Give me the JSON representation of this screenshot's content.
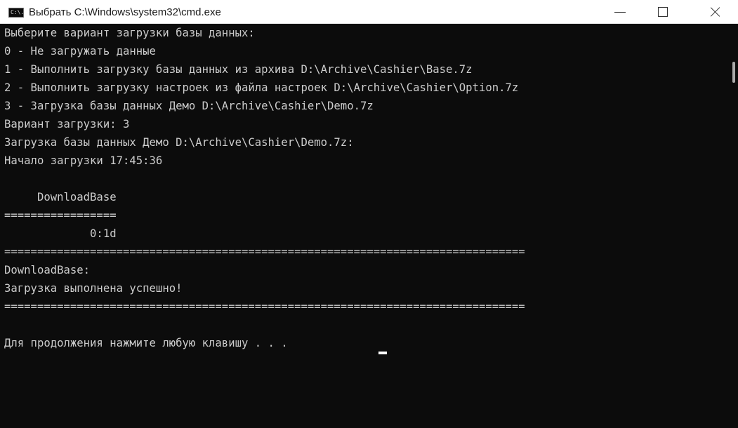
{
  "window": {
    "title": "Выбрать C:\\Windows\\system32\\cmd.exe",
    "icon": "cmd-icon",
    "icon_text": "C:\\."
  },
  "controls": {
    "minimize": "minimize-icon",
    "maximize": "maximize-icon",
    "close": "close-icon"
  },
  "console": {
    "lines": [
      "Выберите вариант загрузки базы данных:",
      "0 - Не загружать данные",
      "1 - Выполнить загрузку базы данных из архива D:\\Archive\\Cashier\\Base.7z",
      "2 - Выполнить загрузку настроек из файла настроек D:\\Archive\\Cashier\\Option.7z",
      "3 - Загрузка базы данных Демо D:\\Archive\\Cashier\\Demo.7z",
      "Вариант загрузки: 3",
      "Загрузка базы данных Демо D:\\Archive\\Cashier\\Demo.7z:",
      "Начало загрузки 17:45:36",
      "",
      "     DownloadBase",
      "=================",
      "             0:1d",
      "===============================================================================",
      "DownloadBase:",
      "Загрузка выполнена успешно!",
      "===============================================================================",
      "",
      "Для продолжения нажмите любую клавишу . . . "
    ]
  },
  "colors": {
    "console_bg": "#0c0c0c",
    "console_fg": "#cccccc",
    "titlebar_bg": "#ffffff"
  }
}
